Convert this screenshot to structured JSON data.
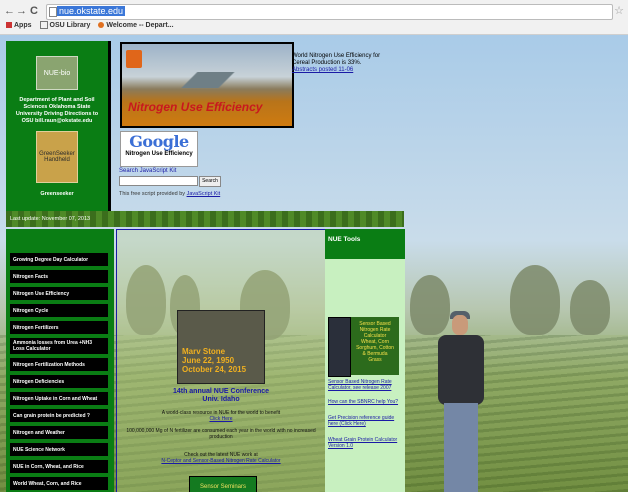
{
  "browser": {
    "url": "nue.okstate.edu",
    "back_glyph": "←",
    "forward_glyph": "→",
    "reload_glyph": "C",
    "star_glyph": "☆",
    "bookmarks": [
      "Apps",
      "OSU Library",
      "Welcome -- Depart..."
    ]
  },
  "sidebar_top": {
    "logo_label": "NUE-bio",
    "department": "Department of Plant and Soil Sciences Oklahoma State University Driving Directions to OSU bill.raun@okstate.edu",
    "greenseeker_image_label": "GreenSeeker Handheld",
    "greenseeker_label": "Greenseeker"
  },
  "banner": {
    "title": "Nitrogen Use Efficiency"
  },
  "world_nue": {
    "text": "World Nitrogen Use Efficiency for Cereal Production is 33%.",
    "link": "Abstracts posted 11-06"
  },
  "google_search": {
    "logo": "Google",
    "subtitle": "Nitrogen Use Efficiency",
    "search_link": "Search JavaScript Kit",
    "button": "Search",
    "powered_text": "This free script provided by",
    "powered_link": "JavaScript Kit"
  },
  "update_bar": "Last update: November 07, 2013",
  "menu": [
    "Growing Degree Day Calculator",
    "Nitrogen Facts",
    "Nitrogen Use Efficiency",
    "Nitrogen Cycle",
    "Nitrogen Fertilizers",
    "Ammonia losses from Urea +NH3 Loss Calculator",
    "Nitrogen Fertilization Methods",
    "Nitrogen Deficiencies",
    "Nitrogen Uptake in Corn and Wheat",
    "Can grain protein be predicted ?",
    "Nitrogen and Weather",
    "NUE Science Network",
    "NUE in Corn, Wheat, and Rice",
    "World Wheat, Corn, and Rice"
  ],
  "center": {
    "photo_caption": [
      "Marv Stone",
      "June 22, 1950",
      "October 24, 2015"
    ],
    "conference_title": "14th annual NUE Conference",
    "conference_location": "Univ. Idaho",
    "text_1": "A world-class resource in NUE for the world to benefit",
    "link_1": "Click Here",
    "text_2": "100,000,000 Mg of N fertilizer are consumed each year in the world with no increased production",
    "text_3": "Check out the latest NUE work at",
    "link_2": "N-Ceptor and Sensor-Based Nitrogen Rate Calculator",
    "button": "Sensor Seminars"
  },
  "tools": {
    "header": "NUE Tools",
    "panel_lines": [
      "Sensor Based",
      "Nitrogen Rate",
      "Calculator",
      "Wheat, Corn",
      "Sorghum, Cotton",
      "& Bermuda",
      "Grass"
    ],
    "link_1": "Sensor Based Nitrogen Rate Calculator, see release 2007",
    "link_2": "How can the SBNRC help You?",
    "link_3": "Get Precision reference guide here (Click Here)",
    "link_4": "Wheat Grain Protein Calculator Version 1.0"
  }
}
